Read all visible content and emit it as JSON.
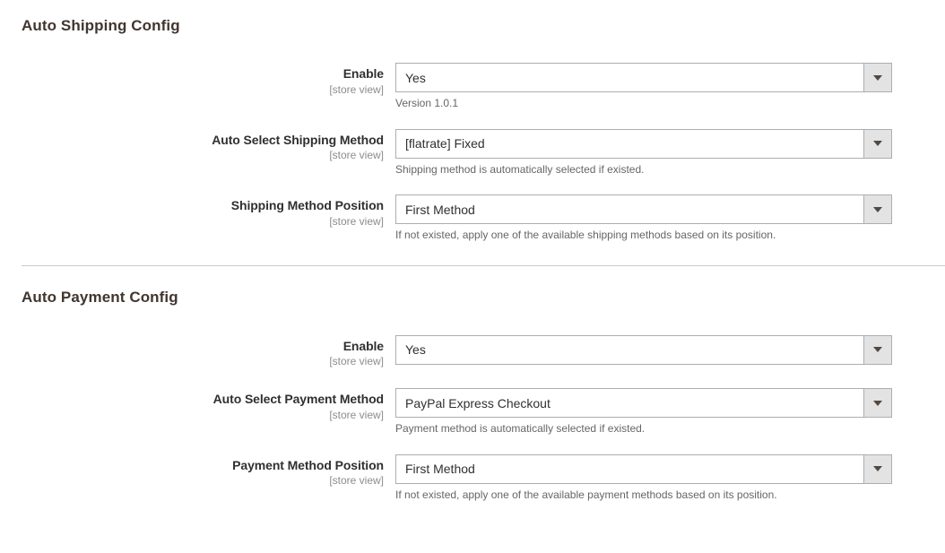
{
  "sections": [
    {
      "id": "auto-shipping-config",
      "title": "Auto Shipping Config",
      "has_divider": false,
      "fields": [
        {
          "id": "shipping-enable",
          "label": "Enable",
          "scope": "[store view]",
          "value": "Yes",
          "note": "Version 1.0.1"
        },
        {
          "id": "auto-select-shipping-method",
          "label": "Auto Select Shipping Method",
          "scope": "[store view]",
          "value": "[flatrate] Fixed",
          "note": "Shipping method is automatically selected if existed."
        },
        {
          "id": "shipping-method-position",
          "label": "Shipping Method Position",
          "scope": "[store view]",
          "value": "First Method",
          "note": "If not existed, apply one of the available shipping methods based on its position."
        }
      ]
    },
    {
      "id": "auto-payment-config",
      "title": "Auto Payment Config",
      "has_divider": true,
      "fields": [
        {
          "id": "payment-enable",
          "label": "Enable",
          "scope": "[store view]",
          "value": "Yes",
          "note": ""
        },
        {
          "id": "auto-select-payment-method",
          "label": "Auto Select Payment Method",
          "scope": "[store view]",
          "value": "PayPal Express Checkout",
          "note": "Payment method is automatically selected if existed."
        },
        {
          "id": "payment-method-position",
          "label": "Payment Method Position",
          "scope": "[store view]",
          "value": "First Method",
          "note": "If not existed, apply one of the available payment methods based on its position."
        }
      ]
    }
  ],
  "icons": {
    "select_caret": "chevron-down-icon"
  },
  "colors": {
    "heading": "#41362f",
    "label": "#303030",
    "scope": "#8c8c8c",
    "note": "#666666",
    "select_border": "#adadad",
    "select_button_bg": "#e3e3e3",
    "divider": "#cacaca",
    "background": "#ffffff"
  }
}
